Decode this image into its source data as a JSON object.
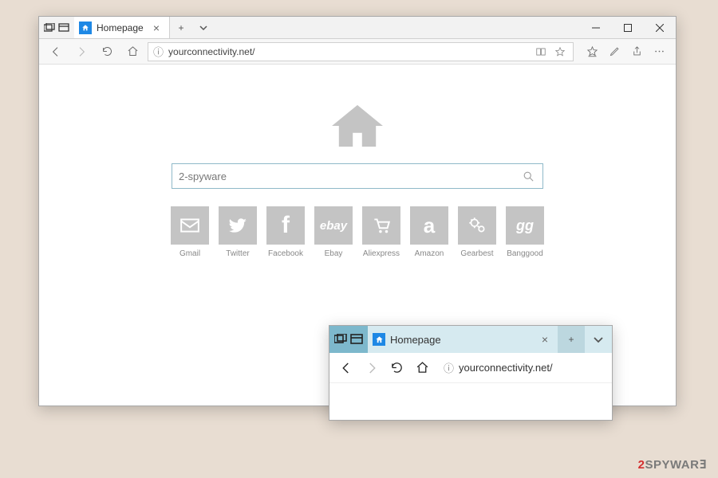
{
  "main": {
    "tab": {
      "title": "Homepage"
    },
    "url": "yourconnectivity.net/",
    "search_value": "2-spyware",
    "tiles": [
      {
        "label": "Gmail",
        "icon": "mail-icon"
      },
      {
        "label": "Twitter",
        "icon": "twitter-icon"
      },
      {
        "label": "Facebook",
        "icon": "facebook-icon"
      },
      {
        "label": "Ebay",
        "icon": "ebay-icon"
      },
      {
        "label": "Aliexpress",
        "icon": "cart-icon"
      },
      {
        "label": "Amazon",
        "icon": "amazon-icon"
      },
      {
        "label": "Gearbest",
        "icon": "gears-icon"
      },
      {
        "label": "Banggood",
        "icon": "gg-icon"
      }
    ]
  },
  "mini": {
    "tab": {
      "title": "Homepage"
    },
    "url": "yourconnectivity.net/"
  },
  "watermark": {
    "prefix": "2",
    "text": "SPYWAR"
  }
}
